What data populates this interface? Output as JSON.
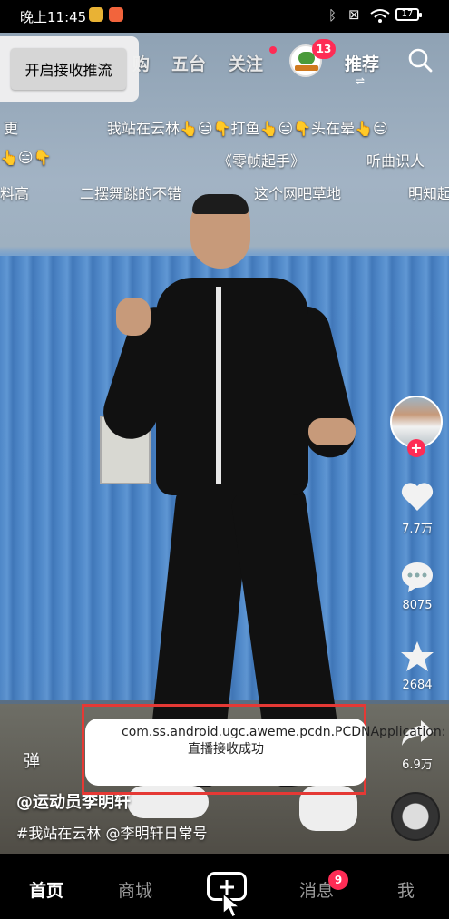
{
  "status_bar": {
    "time": "晚上11:45",
    "battery": "17",
    "app_icon_colors": [
      "#e9b234",
      "#f2643c"
    ]
  },
  "top_nav": {
    "receive_button": "开启接收推流",
    "tabs": [
      "购",
      "五台",
      "关注",
      "推荐"
    ],
    "brand_badge": "13",
    "refresh_arrows": "⇌",
    "search_icon": "search-icon"
  },
  "danmaku": [
    "更",
    "我站在云林👆😑👇打鱼👆😑👇头在晕👆😑",
    "👆😑👇",
    "《零帧起手》",
    "听曲识人",
    "料高",
    "二摆舞跳的不错",
    "这个网吧草地",
    "明知起"
  ],
  "right_rail": {
    "like_count": "7.7万",
    "comment_count": "8075",
    "favorite_count": "2684",
    "share_count": "6.9万",
    "follow_plus": "+"
  },
  "caption": {
    "danmaku_toggle": "弹",
    "author": "@运动员李明轩",
    "description": "#我站在云林 @李明轩日常号"
  },
  "toast": {
    "message": "com.ss.android.ugc.aweme.pcdn.PCDNApplication: 直播接收成功"
  },
  "bottom_bar": {
    "tabs": [
      "首页",
      "商城",
      "消息",
      "我"
    ],
    "message_badge": "9"
  },
  "colors": {
    "accent": "#fe2c55",
    "toast_frame": "#e53935"
  }
}
